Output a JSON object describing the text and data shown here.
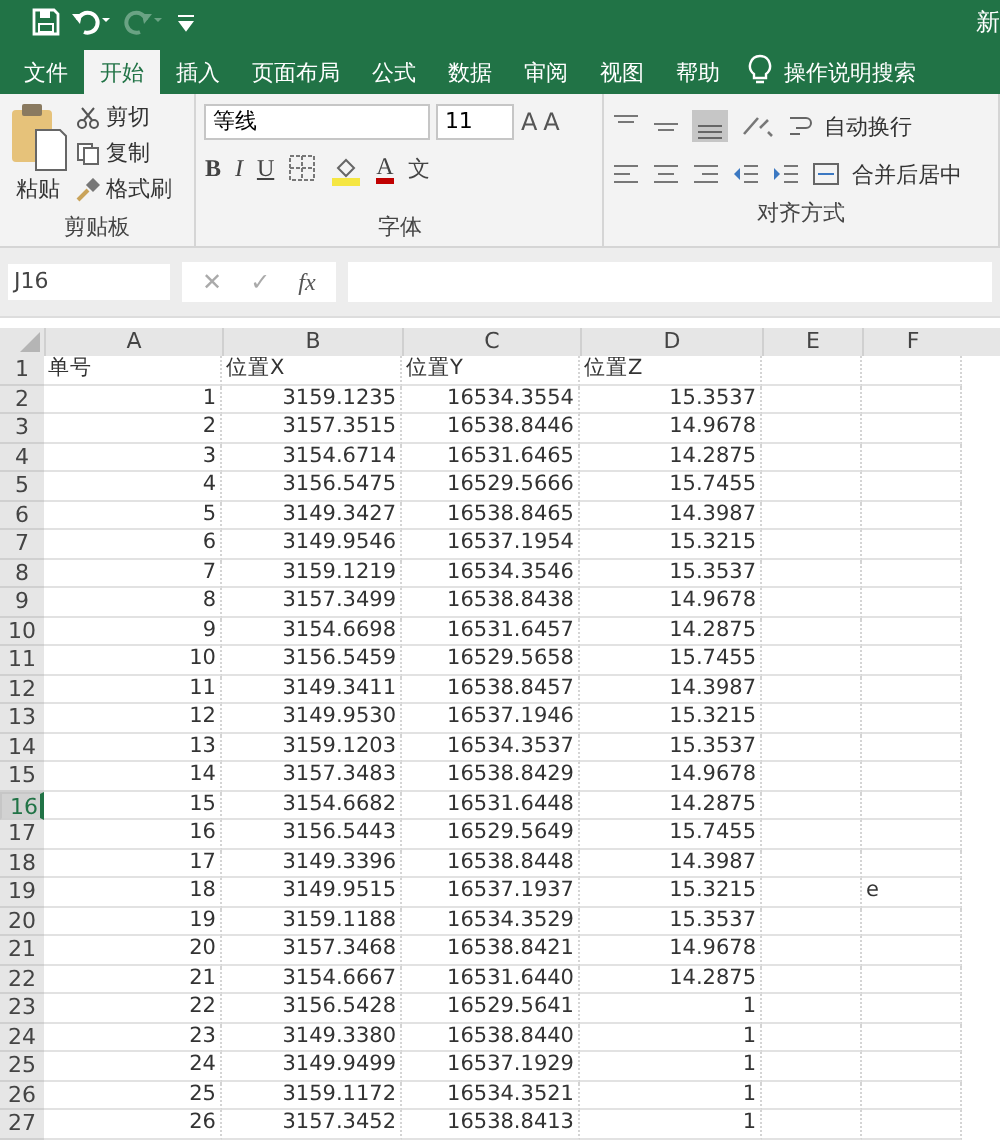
{
  "title_bar": {
    "title_fragment": "新"
  },
  "tabs": [
    {
      "label": "文件",
      "selected": false
    },
    {
      "label": "开始",
      "selected": true
    },
    {
      "label": "插入",
      "selected": false
    },
    {
      "label": "页面布局",
      "selected": false
    },
    {
      "label": "公式",
      "selected": false
    },
    {
      "label": "数据",
      "selected": false
    },
    {
      "label": "审阅",
      "selected": false
    },
    {
      "label": "视图",
      "selected": false
    },
    {
      "label": "帮助",
      "selected": false
    }
  ],
  "tell_me": "操作说明搜索",
  "clipboard": {
    "paste": "粘贴",
    "cut": "剪切",
    "copy": "复制",
    "format_painter": "格式刷",
    "group": "剪贴板"
  },
  "font": {
    "name": "等线",
    "size": "11",
    "bold": "B",
    "italic": "I",
    "underline": "U",
    "grow_letter": "A",
    "shrink_letter": "A",
    "color_letter": "A",
    "phonetic": "文",
    "group": "字体"
  },
  "alignment": {
    "wrap": "自动换行",
    "merge": "合并后居中",
    "group": "对齐方式"
  },
  "name_box": "J16",
  "formula_bar": {
    "cancel": "✕",
    "enter": "✓",
    "function": "fx"
  },
  "columns": [
    "A",
    "B",
    "C",
    "D",
    "E",
    "F"
  ],
  "rows": [
    {
      "header": "1",
      "kind": "heading",
      "selected": false,
      "a": "单号",
      "b": "位置X",
      "c": "位置Y",
      "d": "位置Z"
    },
    {
      "header": "2",
      "kind": "data",
      "selected": false,
      "a": "1",
      "b": "3159.1235",
      "c": "16534.3554",
      "d": "15.3537"
    },
    {
      "header": "3",
      "kind": "data",
      "selected": false,
      "a": "2",
      "b": "3157.3515",
      "c": "16538.8446",
      "d": "14.9678"
    },
    {
      "header": "4",
      "kind": "data",
      "selected": false,
      "a": "3",
      "b": "3154.6714",
      "c": "16531.6465",
      "d": "14.2875"
    },
    {
      "header": "5",
      "kind": "data",
      "selected": false,
      "a": "4",
      "b": "3156.5475",
      "c": "16529.5666",
      "d": "15.7455"
    },
    {
      "header": "6",
      "kind": "data",
      "selected": false,
      "a": "5",
      "b": "3149.3427",
      "c": "16538.8465",
      "d": "14.3987"
    },
    {
      "header": "7",
      "kind": "data",
      "selected": false,
      "a": "6",
      "b": "3149.9546",
      "c": "16537.1954",
      "d": "15.3215"
    },
    {
      "header": "8",
      "kind": "data",
      "selected": false,
      "a": "7",
      "b": "3159.1219",
      "c": "16534.3546",
      "d": "15.3537"
    },
    {
      "header": "9",
      "kind": "data",
      "selected": false,
      "a": "8",
      "b": "3157.3499",
      "c": "16538.8438",
      "d": "14.9678"
    },
    {
      "header": "10",
      "kind": "data",
      "selected": false,
      "a": "9",
      "b": "3154.6698",
      "c": "16531.6457",
      "d": "14.2875"
    },
    {
      "header": "11",
      "kind": "data",
      "selected": false,
      "a": "10",
      "b": "3156.5459",
      "c": "16529.5658",
      "d": "15.7455"
    },
    {
      "header": "12",
      "kind": "data",
      "selected": false,
      "a": "11",
      "b": "3149.3411",
      "c": "16538.8457",
      "d": "14.3987"
    },
    {
      "header": "13",
      "kind": "data",
      "selected": false,
      "a": "12",
      "b": "3149.9530",
      "c": "16537.1946",
      "d": "15.3215"
    },
    {
      "header": "14",
      "kind": "data",
      "selected": false,
      "a": "13",
      "b": "3159.1203",
      "c": "16534.3537",
      "d": "15.3537"
    },
    {
      "header": "15",
      "kind": "data",
      "selected": false,
      "a": "14",
      "b": "3157.3483",
      "c": "16538.8429",
      "d": "14.9678"
    },
    {
      "header": "16",
      "kind": "data",
      "selected": true,
      "a": "15",
      "b": "3154.6682",
      "c": "16531.6448",
      "d": "14.2875"
    },
    {
      "header": "17",
      "kind": "data",
      "selected": false,
      "a": "16",
      "b": "3156.5443",
      "c": "16529.5649",
      "d": "15.7455"
    },
    {
      "header": "18",
      "kind": "data",
      "selected": false,
      "a": "17",
      "b": "3149.3396",
      "c": "16538.8448",
      "d": "14.3987"
    },
    {
      "header": "19",
      "kind": "data",
      "selected": false,
      "a": "18",
      "b": "3149.9515",
      "c": "16537.1937",
      "d": "15.3215",
      "f": "e"
    },
    {
      "header": "20",
      "kind": "data",
      "selected": false,
      "a": "19",
      "b": "3159.1188",
      "c": "16534.3529",
      "d": "15.3537"
    },
    {
      "header": "21",
      "kind": "data",
      "selected": false,
      "a": "20",
      "b": "3157.3468",
      "c": "16538.8421",
      "d": "14.9678"
    },
    {
      "header": "22",
      "kind": "data",
      "selected": false,
      "a": "21",
      "b": "3154.6667",
      "c": "16531.6440",
      "d": "14.2875"
    },
    {
      "header": "23",
      "kind": "data",
      "selected": false,
      "a": "22",
      "b": "3156.5428",
      "c": "16529.5641",
      "d": "1"
    },
    {
      "header": "24",
      "kind": "data",
      "selected": false,
      "a": "23",
      "b": "3149.3380",
      "c": "16538.8440",
      "d": "1"
    },
    {
      "header": "25",
      "kind": "data",
      "selected": false,
      "a": "24",
      "b": "3149.9499",
      "c": "16537.1929",
      "d": "1"
    },
    {
      "header": "26",
      "kind": "data",
      "selected": false,
      "a": "25",
      "b": "3159.1172",
      "c": "16534.3521",
      "d": "1"
    },
    {
      "header": "27",
      "kind": "data",
      "selected": false,
      "a": "26",
      "b": "3157.3452",
      "c": "16538.8413",
      "d": "1"
    }
  ]
}
